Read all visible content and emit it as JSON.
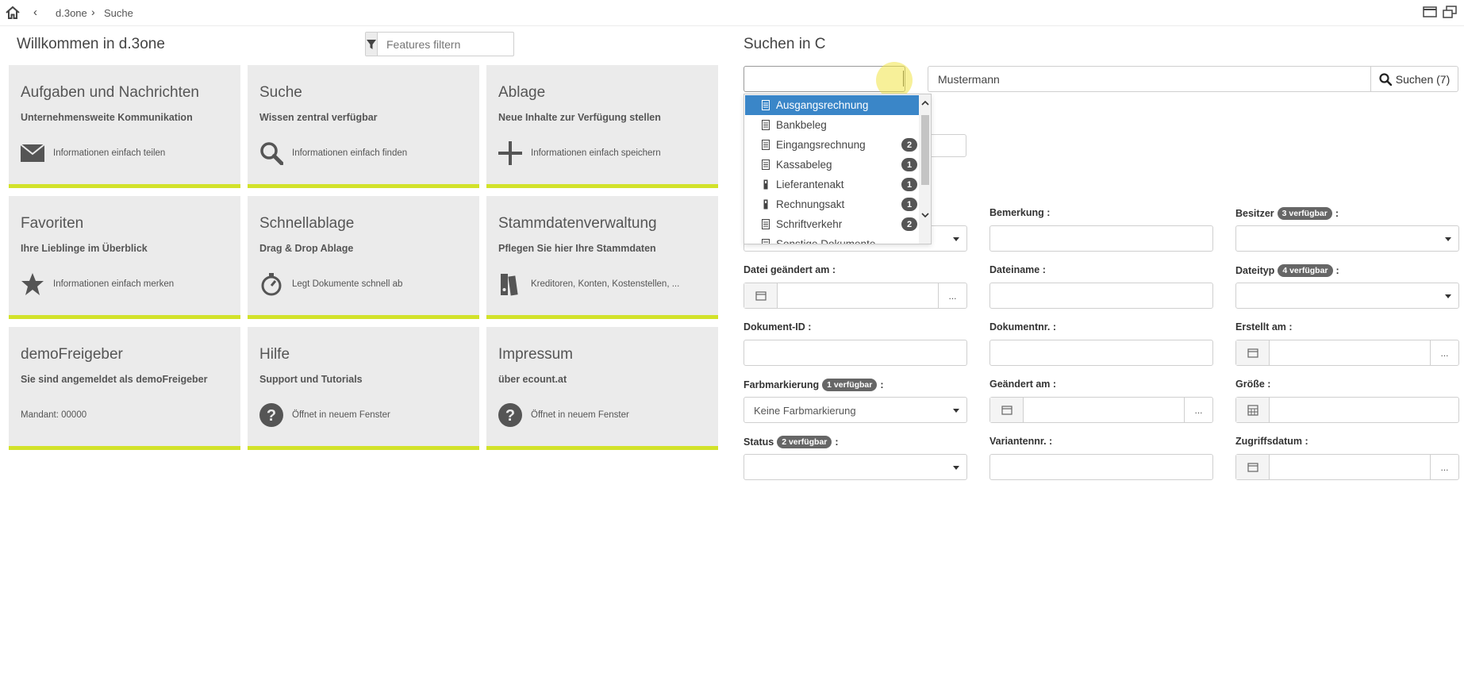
{
  "topbar": {
    "home_icon": "home-icon",
    "back_icon": "chevron-left-icon",
    "breadcrumb": [
      "d.3one",
      "Suche"
    ],
    "separator": "›",
    "window_icons": [
      "window-maximize-icon",
      "window-restore-icon"
    ]
  },
  "left": {
    "title": "Willkommen in d.3one",
    "filter_placeholder": "Features filtern",
    "tiles": [
      {
        "title": "Aufgaben und Nachrichten",
        "subtitle": "Unternehmensweite Kommunikation",
        "icon": "mail-icon",
        "footer": "Informationen einfach teilen"
      },
      {
        "title": "Suche",
        "subtitle": "Wissen zentral verfügbar",
        "icon": "search-icon",
        "footer": "Informationen einfach finden"
      },
      {
        "title": "Ablage",
        "subtitle": "Neue Inhalte zur Verfügung stellen",
        "icon": "plus-icon",
        "footer": "Informationen einfach speichern"
      },
      {
        "title": "Favoriten",
        "subtitle": "Ihre Lieblinge im Überblick",
        "icon": "star-icon",
        "footer": "Informationen einfach merken"
      },
      {
        "title": "Schnellablage",
        "subtitle": "Drag & Drop Ablage",
        "icon": "stopwatch-icon",
        "footer": "Legt Dokumente schnell ab"
      },
      {
        "title": "Stammdatenverwaltung",
        "subtitle": "Pflegen Sie hier Ihre Stammdaten",
        "icon": "binders-icon",
        "footer": "Kreditoren, Konten, Kostenstellen, ..."
      },
      {
        "title": "demoFreigeber",
        "subtitle": "Sie sind angemeldet als demoFreigeber",
        "icon": "",
        "footer": "Mandant: 00000"
      },
      {
        "title": "Hilfe",
        "subtitle": "Support und Tutorials",
        "icon": "question-icon",
        "footer": "Öffnet in neuem Fenster"
      },
      {
        "title": "Impressum",
        "subtitle": "über ecount.at",
        "icon": "question-icon",
        "footer": "Öffnet in neuem Fenster"
      }
    ],
    "accent_color": "#d2e22a"
  },
  "right": {
    "title": "Suchen in C",
    "combo_value": "",
    "search_value": "Mustermann",
    "search_button": "Suchen (7)",
    "dropdown": [
      {
        "label": "Ausgangsrechnung",
        "count": "",
        "icon": "document-icon",
        "selected": true
      },
      {
        "label": "Bankbeleg",
        "count": "",
        "icon": "document-icon",
        "selected": false
      },
      {
        "label": "Eingangsrechnung",
        "count": "2",
        "icon": "document-icon",
        "selected": false
      },
      {
        "label": "Kassabeleg",
        "count": "1",
        "icon": "document-icon",
        "selected": false
      },
      {
        "label": "Lieferantenakt",
        "count": "1",
        "icon": "folder-icon",
        "selected": false
      },
      {
        "label": "Rechnungsakt",
        "count": "1",
        "icon": "folder-icon",
        "selected": false
      },
      {
        "label": "Schriftverkehr",
        "count": "2",
        "icon": "document-icon",
        "selected": false
      },
      {
        "label": "Sonstige Dokumente",
        "count": "",
        "icon": "document-icon",
        "selected": false
      }
    ],
    "selected_color": "#3a86c8",
    "form": {
      "bemerkung": "Bemerkung :",
      "besitzer": "Besitzer",
      "besitzer_pill": "3 verfügbar",
      "datei_geaendert": "Datei geändert am :",
      "dateiname": "Dateiname :",
      "dateityp": "Dateityp",
      "dateityp_pill": "4 verfügbar",
      "dokument_id": "Dokument-ID :",
      "dokumentnr": "Dokumentnr. :",
      "erstellt": "Erstellt am :",
      "farbmarkierung": "Farbmarkierung",
      "farb_pill": "1 verfügbar",
      "farb_value": "Keine Farbmarkierung",
      "geaendert": "Geändert am :",
      "groesse": "Größe :",
      "status": "Status",
      "status_pill": "2 verfügbar",
      "variantennr": "Variantennr. :",
      "zugriffsdatum": "Zugriffsdatum :",
      "colon": ":",
      "more": "..."
    }
  }
}
